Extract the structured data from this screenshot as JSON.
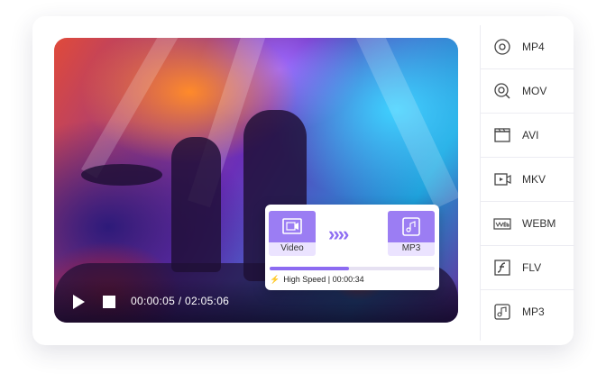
{
  "player": {
    "current_time": "00:00:05",
    "separator": "/",
    "total_time": "02:05:06"
  },
  "converter": {
    "source_label": "Video",
    "target_label": "MP3",
    "arrows": "››››",
    "progress": 0.48,
    "speed_label": "High Speed",
    "divider": "|",
    "elapsed": "00:00:34",
    "accent_color": "#9b7df3"
  },
  "formats": [
    {
      "label": "MP4",
      "icon": "disc-icon"
    },
    {
      "label": "MOV",
      "icon": "magnifier-disc-icon"
    },
    {
      "label": "AVI",
      "icon": "clapperboard-icon"
    },
    {
      "label": "MKV",
      "icon": "video-camera-icon"
    },
    {
      "label": "WEBM",
      "icon": "webm-icon"
    },
    {
      "label": "FLV",
      "icon": "flash-icon"
    },
    {
      "label": "MP3",
      "icon": "audio-file-icon"
    }
  ]
}
